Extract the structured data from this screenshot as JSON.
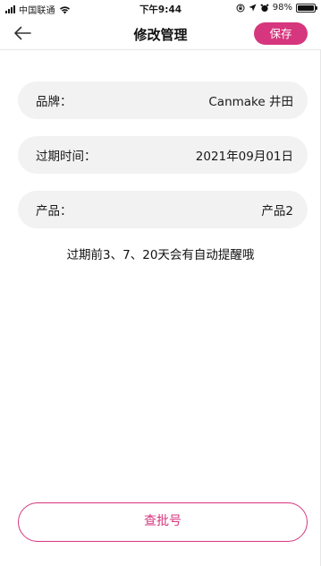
{
  "status_bar": {
    "carrier": "中国联通",
    "time": "下午9:44",
    "battery": "98%",
    "battery_level": 0.98
  },
  "nav": {
    "title": "修改管理",
    "save_label": "保存"
  },
  "fields": {
    "brand": {
      "label": "品牌：",
      "value": "Canmake 井田"
    },
    "expiry": {
      "label": "过期时间：",
      "value": "2021年09月01日"
    },
    "product": {
      "label": "产品：",
      "value": "产品2"
    }
  },
  "reminder_text": "过期前3、7、20天会有自动提醒哦",
  "check_batch_label": "查批号",
  "colors": {
    "accent": "#d6367d",
    "field_bg": "#f2f2f2"
  }
}
